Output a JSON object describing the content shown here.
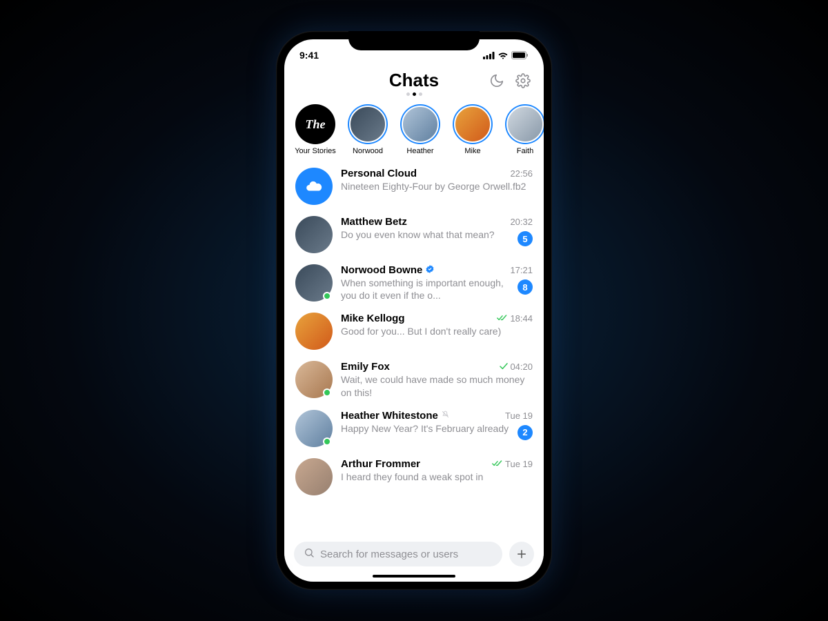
{
  "status": {
    "time": "9:41"
  },
  "header": {
    "title": "Chats"
  },
  "stories": [
    {
      "label": "Your Stories",
      "own": true,
      "text": "The"
    },
    {
      "label": "Norwood"
    },
    {
      "label": "Heather"
    },
    {
      "label": "Mike"
    },
    {
      "label": "Faith"
    }
  ],
  "chats": [
    {
      "name": "Personal Cloud",
      "msg": "Nineteen Eighty-Four by George Orwell.fb2",
      "time": "22:56",
      "cloud": true
    },
    {
      "name": "Matthew Betz",
      "msg": "Do you even know what that mean?",
      "time": "20:32",
      "badge": "5",
      "avatar": "g1"
    },
    {
      "name": "Norwood Bowne",
      "msg": "When something is important enough, you do it even if the o...",
      "time": "17:21",
      "badge": "8",
      "verified": true,
      "online": true,
      "avatar": "g1"
    },
    {
      "name": "Mike Kellogg",
      "msg": "Good for you... But I don't really care)",
      "time": "18:44",
      "read": "double",
      "avatar": "g2"
    },
    {
      "name": "Emily Fox",
      "msg": "Wait, we could have made so much money on this!",
      "time": "04:20",
      "read": "single",
      "online": true,
      "avatar": "g3"
    },
    {
      "name": "Heather Whitestone",
      "msg": "Happy New Year? It's February already",
      "time": "Tue 19",
      "badge": "2",
      "muted": true,
      "online": true,
      "avatar": "g5"
    },
    {
      "name": "Arthur Frommer",
      "msg": "I heard they found a weak spot in",
      "time": "Tue 19",
      "read": "double",
      "avatar": "g6"
    }
  ],
  "search": {
    "placeholder": "Search for messages or users"
  },
  "colors": {
    "accent": "#1e88ff",
    "online": "#34c759",
    "muted": "#8e8e93"
  }
}
